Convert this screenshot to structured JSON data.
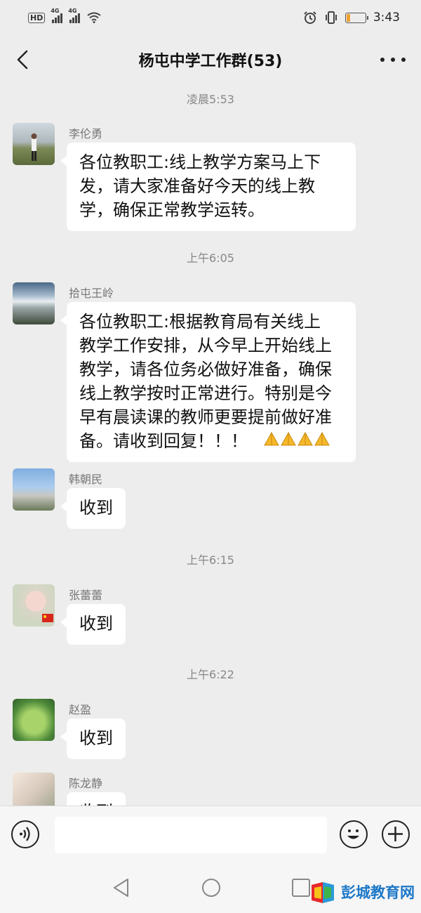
{
  "status_bar": {
    "hd_label": "HD",
    "net1": "4G",
    "net2": "4G",
    "battery_level": 0.2,
    "time": "3:43"
  },
  "header": {
    "back_icon": "chevron-left-icon",
    "title": "杨屯中学工作群(53)",
    "more_icon": "more-dots-icon"
  },
  "chat": {
    "timestamps": [
      "凌晨5:53",
      "上午6:05",
      "上午6:15",
      "上午6:22"
    ],
    "messages": [
      {
        "sender": "李伦勇",
        "text": "各位教职工:线上教学方案马上下\n发，请大家准备好今天的线上教\n学，确保正常教学运转。"
      },
      {
        "sender": "拾屯王岭",
        "text": "各位教职工:根据教育局有关线上\n教学工作安排，从今早上开始线上\n教学，请各位务必做好准备，确保\n线上教学按时正常进行。特别是今\n早有晨读课的教师更要提前做好准\n备。请收到回复！！！",
        "emoji_icon": "folded-hands-icon",
        "emoji_count": 4
      },
      {
        "sender": "韩朝民",
        "text": "收到"
      },
      {
        "sender": "张蕾蕾",
        "text": "收到"
      },
      {
        "sender": "赵盈",
        "text": "收到"
      },
      {
        "sender": "陈龙静",
        "text": "收到"
      }
    ]
  },
  "input_bar": {
    "voice_icon": "voice-icon",
    "input_value": "",
    "emoji_icon": "smiley-icon",
    "plus_icon": "plus-icon"
  },
  "nav_bar": {
    "back_icon": "triangle-back-icon",
    "home_icon": "circle-home-icon",
    "recent_icon": "square-recent-icon"
  },
  "watermark": {
    "text": "彭城教育网"
  },
  "colors": {
    "background": "#ededed",
    "bubble": "#ffffff",
    "timestamp": "#888888",
    "watermark_blue": "#1d78c8"
  }
}
